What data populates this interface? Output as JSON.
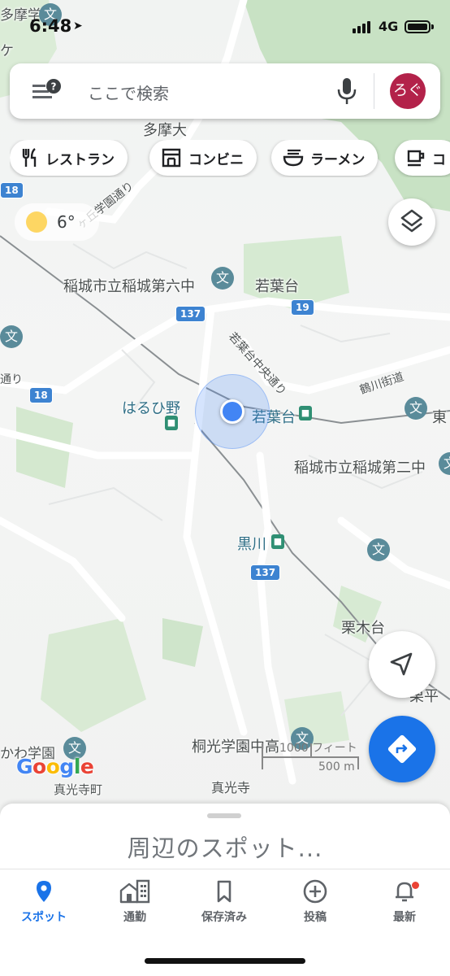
{
  "status_bar": {
    "time": "6:48",
    "network": "4G"
  },
  "search": {
    "placeholder": "ここで検索",
    "avatar_text": "ろぐ"
  },
  "chips": [
    {
      "label": "レストラン",
      "icon": "restaurant-icon"
    },
    {
      "label": "コンビニ",
      "icon": "convenience-store-icon"
    },
    {
      "label": "ラーメン",
      "icon": "ramen-icon"
    },
    {
      "label": "コ",
      "icon": "cafe-icon"
    }
  ],
  "weather": {
    "temp": "6°",
    "icon": "sun-icon"
  },
  "map": {
    "labels": {
      "tama_gakuen": "多摩学園",
      "tamadai": "多摩大",
      "ke": "ケ",
      "gaoka_dori": "ヶ丘学園通り",
      "dai6": "稲城市立稲城第六中",
      "wakabadai": "若葉台",
      "wakaba_chuo": "若葉台中央通り",
      "tsurukawa": "鶴川街道",
      "haruhino": "はるひ野",
      "wakabadai_st": "若葉台",
      "higashi": "東",
      "dai2": "稲城市立稲城第二中",
      "dori_left": "通り",
      "kurokawa": "黒川",
      "kurikidai": "栗木台",
      "hira": "栗平",
      "toko": "桐光学園中高",
      "kawa_gakuen": "かわ学園",
      "shinkoji_cho": "真光寺町",
      "shinkoji": "真光寺",
      "ma": "摩"
    },
    "route_numbers": {
      "r18a": "18",
      "r18b": "18",
      "r137a": "137",
      "r137b": "137",
      "r19": "19"
    },
    "scale": {
      "feet": "1000 フィート",
      "meters": "500 m"
    }
  },
  "branding": {
    "google": [
      "G",
      "o",
      "o",
      "g",
      "l",
      "e"
    ]
  },
  "sheet": {
    "title": "周辺のスポット..."
  },
  "nav": [
    {
      "label": "スポット",
      "icon": "pin-icon",
      "active": true
    },
    {
      "label": "通勤",
      "icon": "commute-icon"
    },
    {
      "label": "保存済み",
      "icon": "bookmark-icon"
    },
    {
      "label": "投稿",
      "icon": "add-circle-icon"
    },
    {
      "label": "最新",
      "icon": "bell-icon"
    }
  ],
  "colors": {
    "accent": "#1a73e8",
    "location": "#4285f4",
    "avatar": "#b3224a"
  }
}
